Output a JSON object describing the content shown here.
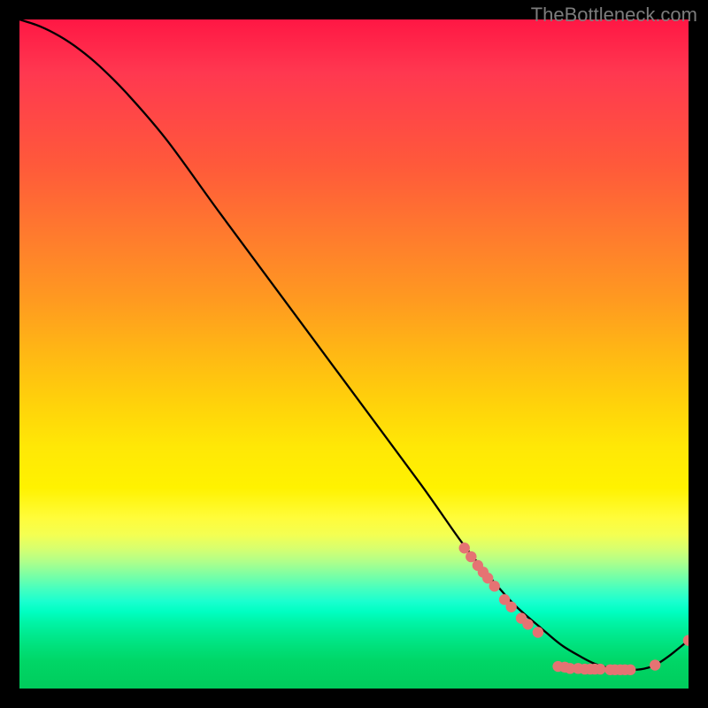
{
  "watermark": "TheBottleneck.com",
  "chart_data": {
    "type": "line",
    "title": "",
    "xlabel": "",
    "ylabel": "",
    "xlim": [
      0,
      100
    ],
    "ylim": [
      0,
      100
    ],
    "curve": {
      "x": [
        0,
        3,
        6,
        9,
        12,
        16,
        22,
        30,
        40,
        50,
        60,
        66,
        70,
        74,
        78,
        81,
        84,
        86,
        88,
        90,
        92,
        93.5,
        95,
        97,
        100
      ],
      "y": [
        100,
        99,
        97.5,
        95.5,
        93,
        89,
        82,
        71,
        57.5,
        44,
        30.5,
        22,
        17,
        12.5,
        9,
        6.5,
        4.7,
        3.7,
        3.1,
        2.8,
        2.8,
        3.0,
        3.5,
        4.8,
        7.2
      ]
    },
    "points": [
      {
        "x": 66.5,
        "y": 21.0
      },
      {
        "x": 67.5,
        "y": 19.7
      },
      {
        "x": 68.5,
        "y": 18.4
      },
      {
        "x": 69.3,
        "y": 17.4
      },
      {
        "x": 70.0,
        "y": 16.5
      },
      {
        "x": 71.0,
        "y": 15.3
      },
      {
        "x": 72.5,
        "y": 13.3
      },
      {
        "x": 73.5,
        "y": 12.2
      },
      {
        "x": 75.0,
        "y": 10.5
      },
      {
        "x": 76.0,
        "y": 9.6
      },
      {
        "x": 77.5,
        "y": 8.4
      },
      {
        "x": 80.5,
        "y": 3.3
      },
      {
        "x": 81.5,
        "y": 3.2
      },
      {
        "x": 82.3,
        "y": 3.0
      },
      {
        "x": 83.5,
        "y": 3.0
      },
      {
        "x": 84.5,
        "y": 2.9
      },
      {
        "x": 85.3,
        "y": 2.9
      },
      {
        "x": 86.0,
        "y": 2.9
      },
      {
        "x": 86.8,
        "y": 2.9
      },
      {
        "x": 88.3,
        "y": 2.8
      },
      {
        "x": 89.0,
        "y": 2.8
      },
      {
        "x": 89.8,
        "y": 2.8
      },
      {
        "x": 90.5,
        "y": 2.8
      },
      {
        "x": 91.3,
        "y": 2.8
      },
      {
        "x": 95.0,
        "y": 3.5
      },
      {
        "x": 100.0,
        "y": 7.2
      }
    ]
  }
}
